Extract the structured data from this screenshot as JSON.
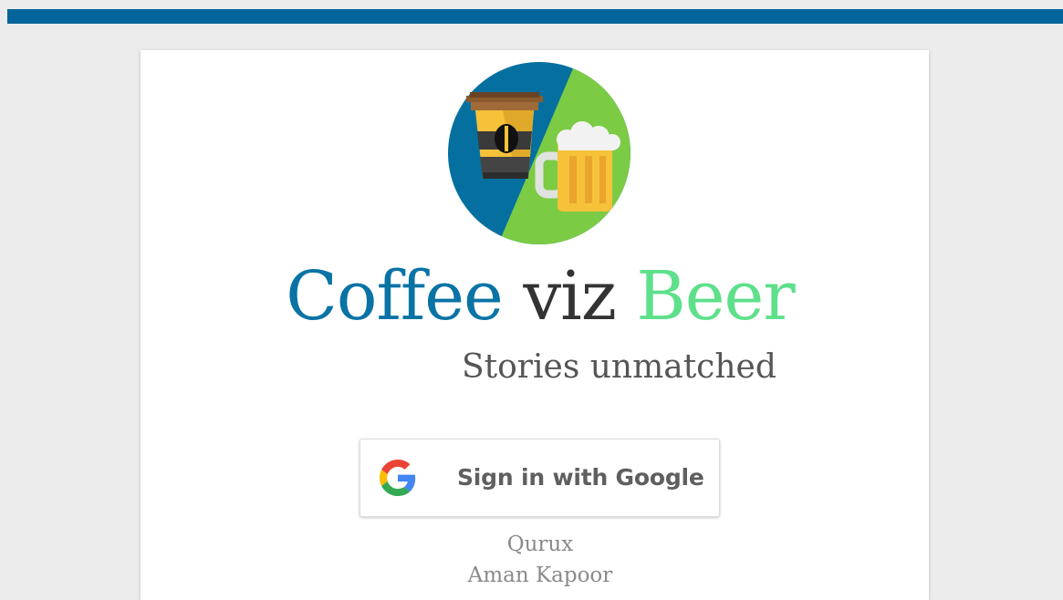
{
  "header": {
    "bar_color": "#05659b"
  },
  "brand": {
    "logo_icon": "coffee-beer-logo-icon",
    "title_word_1": "Coffee",
    "title_word_2": "viz",
    "title_word_3": "Beer",
    "title_colors": [
      "#0a73a5",
      "#333333",
      "#5ee08b"
    ],
    "subtitle": "Stories unmatched"
  },
  "auth": {
    "google_button_label": "Sign in with Google",
    "google_icon": "google-g-icon"
  },
  "footer": {
    "line_1": "Qurux",
    "line_2": "Aman Kapoor"
  }
}
